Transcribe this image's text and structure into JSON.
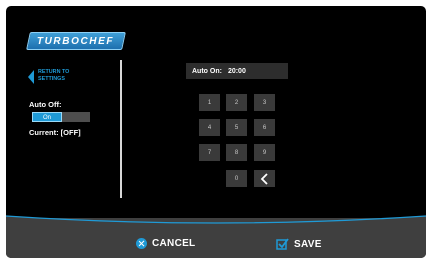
{
  "brand": {
    "logo_text": "TURBOCHEF"
  },
  "sidebar": {
    "return_label": "RETURN TO SETTINGS",
    "auto_off_label": "Auto Off:",
    "toggle_on_label": "On",
    "current_status": "Current: [OFF]"
  },
  "field": {
    "label": "Auto On:",
    "value": "20:00"
  },
  "keypad": {
    "keys": [
      "1",
      "2",
      "3",
      "4",
      "5",
      "6",
      "7",
      "8",
      "9",
      "0"
    ],
    "backspace_icon": "chevron-left-icon"
  },
  "footer": {
    "cancel_label": "CANCEL",
    "save_label": "SAVE"
  },
  "colors": {
    "accent": "#1f9ad6",
    "background": "#000000",
    "bar": "#3f3f3f",
    "key": "#3a3a3a"
  }
}
